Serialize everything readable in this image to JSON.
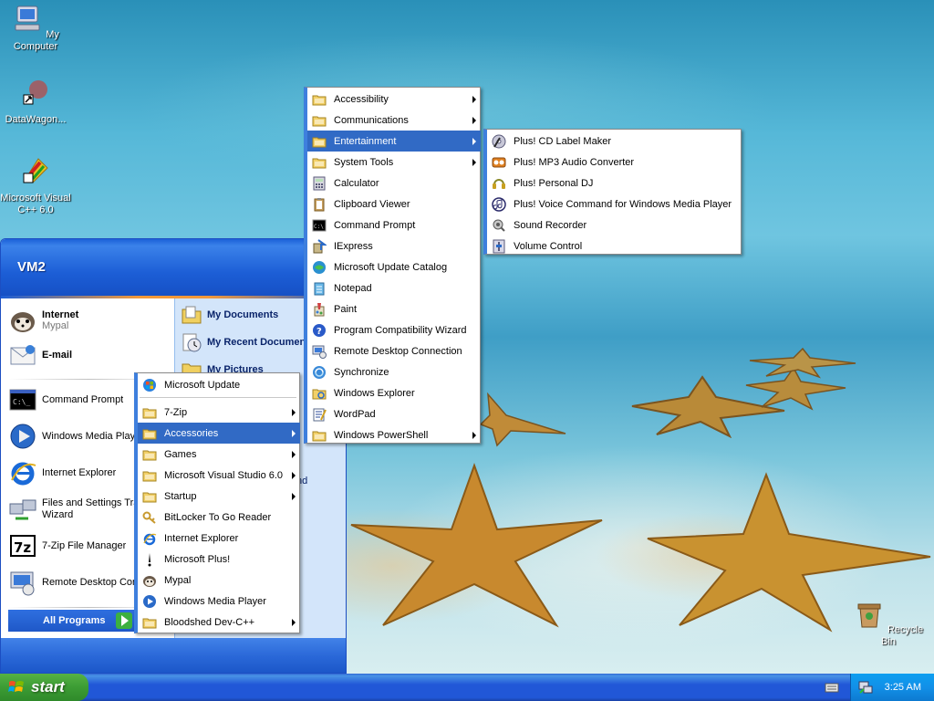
{
  "desktop": {
    "icons": [
      {
        "label": "My Computer",
        "icon": "my-computer-icon"
      },
      {
        "label": "DataWagon...",
        "icon": "datawagon-shortcut-icon"
      },
      {
        "label": "Microsoft Visual C++ 6.0",
        "icon": "visual-cpp-icon"
      },
      {
        "label": "Recycle Bin",
        "icon": "recycle-bin-icon"
      }
    ]
  },
  "start_menu": {
    "user": "VM2",
    "pinned": [
      {
        "title": "Internet",
        "subtitle": "Mypal",
        "icon": "mypal-browser-icon"
      },
      {
        "title": "E-mail",
        "subtitle": "",
        "icon": "email-icon"
      }
    ],
    "recent": [
      {
        "label": "Command Prompt",
        "icon": "command-prompt-icon"
      },
      {
        "label": "Windows Media Player",
        "icon": "media-player-icon"
      },
      {
        "label": "Internet Explorer",
        "icon": "internet-explorer-icon"
      },
      {
        "label": "Files and Settings Transfer Wizard",
        "icon": "transfer-wizard-icon"
      },
      {
        "label": "7-Zip File Manager",
        "icon": "7zip-icon"
      },
      {
        "label": "Remote Desktop Connection",
        "icon": "remote-desktop-icon"
      }
    ],
    "right": [
      {
        "label": "My Documents",
        "icon": "my-documents-icon"
      },
      {
        "label": "My Recent Documents",
        "icon": "recent-documents-icon"
      },
      {
        "label": "My Pictures",
        "icon": "my-pictures-icon"
      }
    ],
    "right_partial": "nd",
    "all_programs": "All Programs"
  },
  "programs_menu": {
    "items": [
      {
        "label": "Microsoft Update",
        "submenu": false,
        "active": false,
        "icon": "windows-update-icon"
      },
      {
        "label": "7-Zip",
        "submenu": true,
        "active": false,
        "icon": "folder-icon"
      },
      {
        "label": "Accessories",
        "submenu": true,
        "active": true,
        "icon": "folder-icon"
      },
      {
        "label": "Games",
        "submenu": true,
        "active": false,
        "icon": "folder-icon"
      },
      {
        "label": "Microsoft Visual Studio 6.0",
        "submenu": true,
        "active": false,
        "icon": "folder-icon"
      },
      {
        "label": "Startup",
        "submenu": true,
        "active": false,
        "icon": "folder-icon"
      },
      {
        "label": "BitLocker To Go Reader",
        "submenu": false,
        "active": false,
        "icon": "bitlocker-icon"
      },
      {
        "label": "Internet Explorer",
        "submenu": false,
        "active": false,
        "icon": "internet-explorer-icon"
      },
      {
        "label": "Microsoft Plus!",
        "submenu": false,
        "active": false,
        "icon": "microsoft-plus-icon"
      },
      {
        "label": "Mypal",
        "submenu": false,
        "active": false,
        "icon": "mypal-browser-icon"
      },
      {
        "label": "Windows Media Player",
        "submenu": false,
        "active": false,
        "icon": "media-player-icon"
      },
      {
        "label": "Bloodshed Dev-C++",
        "submenu": true,
        "active": false,
        "icon": "folder-icon"
      }
    ]
  },
  "accessories_menu": {
    "items": [
      {
        "label": "Accessibility",
        "submenu": true,
        "active": false,
        "icon": "folder-icon"
      },
      {
        "label": "Communications",
        "submenu": true,
        "active": false,
        "icon": "folder-icon"
      },
      {
        "label": "Entertainment",
        "submenu": true,
        "active": true,
        "icon": "folder-icon"
      },
      {
        "label": "System Tools",
        "submenu": true,
        "active": false,
        "icon": "folder-icon"
      },
      {
        "label": "Calculator",
        "submenu": false,
        "active": false,
        "icon": "calculator-icon"
      },
      {
        "label": "Clipboard Viewer",
        "submenu": false,
        "active": false,
        "icon": "clipboard-icon"
      },
      {
        "label": "Command Prompt",
        "submenu": false,
        "active": false,
        "icon": "command-prompt-icon"
      },
      {
        "label": "IExpress",
        "submenu": false,
        "active": false,
        "icon": "iexpress-icon"
      },
      {
        "label": "Microsoft Update Catalog",
        "submenu": false,
        "active": false,
        "icon": "update-catalog-icon"
      },
      {
        "label": "Notepad",
        "submenu": false,
        "active": false,
        "icon": "notepad-icon"
      },
      {
        "label": "Paint",
        "submenu": false,
        "active": false,
        "icon": "paint-icon"
      },
      {
        "label": "Program Compatibility Wizard",
        "submenu": false,
        "active": false,
        "icon": "help-icon"
      },
      {
        "label": "Remote Desktop Connection",
        "submenu": false,
        "active": false,
        "icon": "remote-desktop-icon"
      },
      {
        "label": "Synchronize",
        "submenu": false,
        "active": false,
        "icon": "synchronize-icon"
      },
      {
        "label": "Windows Explorer",
        "submenu": false,
        "active": false,
        "icon": "windows-explorer-icon"
      },
      {
        "label": "WordPad",
        "submenu": false,
        "active": false,
        "icon": "wordpad-icon"
      },
      {
        "label": "Windows PowerShell",
        "submenu": true,
        "active": false,
        "icon": "folder-icon"
      }
    ]
  },
  "entertainment_menu": {
    "items": [
      {
        "label": "Plus! CD Label Maker",
        "icon": "cd-label-maker-icon"
      },
      {
        "label": "Plus! MP3 Audio Converter",
        "icon": "mp3-converter-icon"
      },
      {
        "label": "Plus! Personal DJ",
        "icon": "personal-dj-icon"
      },
      {
        "label": "Plus! Voice Command for Windows Media Player",
        "icon": "voice-command-icon"
      },
      {
        "label": "Sound Recorder",
        "icon": "sound-recorder-icon"
      },
      {
        "label": "Volume Control",
        "icon": "volume-control-icon"
      }
    ]
  },
  "taskbar": {
    "start_label": "start",
    "clock": "3:25 AM"
  },
  "colors": {
    "menu_highlight": "#316ac5",
    "taskbar_blue": "#2157d7",
    "start_green": "#3c9c34",
    "tray_blue": "#1290e8"
  }
}
